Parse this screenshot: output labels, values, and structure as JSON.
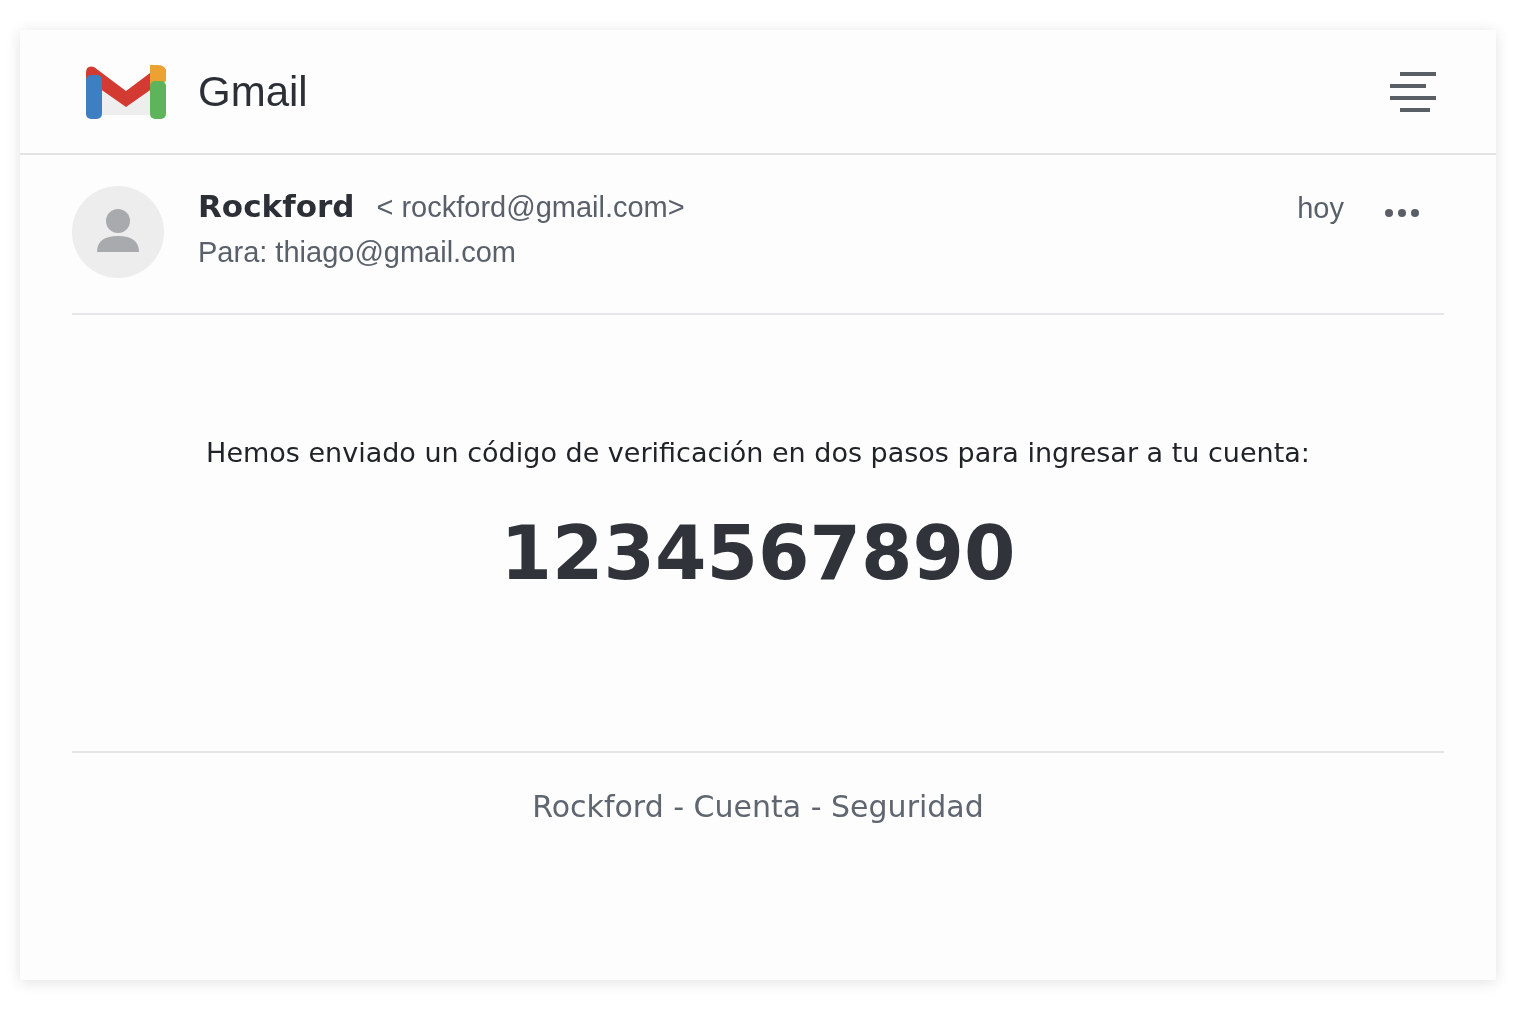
{
  "app": {
    "title": "Gmail"
  },
  "message": {
    "sender": "Rockford",
    "sender_email": "< rockford@gmail.com>",
    "recipient": "Para: thiago@gmail.com",
    "date": "hoy",
    "body": "Hemos enviado un código de verificación en dos pasos para ingresar a tu cuenta:",
    "code": "1234567890"
  },
  "footer": "Rockford - Cuenta - Seguridad"
}
